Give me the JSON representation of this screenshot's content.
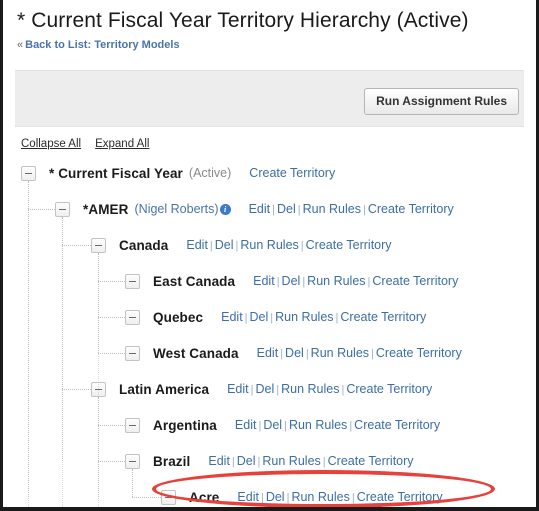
{
  "header": {
    "title": "* Current Fiscal Year Territory Hierarchy (Active)",
    "breadcrumb_chevron": "«",
    "breadcrumb_link": "Back to List: Territory Models"
  },
  "toolbar": {
    "run_assignment_rules_label": "Run Assignment Rules"
  },
  "tree_controls": {
    "collapse_all": "Collapse All",
    "expand_all": "Expand All"
  },
  "actions": {
    "edit": "Edit",
    "del": "Del",
    "run_rules": "Run Rules",
    "create_territory": "Create Territory",
    "separator": "|"
  },
  "colors": {
    "link_blue": "#3b6ea5",
    "annotation_red": "#e8413c",
    "toolbar_gray": "#ededed",
    "info_icon_blue": "#3b7ac4"
  },
  "tree": {
    "rows": [
      {
        "label": "* Current Fiscal Year",
        "meta": "(Active)",
        "owner": "",
        "has_info_icon": false,
        "depth": 0,
        "actions": [
          "create_territory"
        ],
        "highlighted": false
      },
      {
        "label": "*AMER",
        "meta": "",
        "owner": "(Nigel Roberts)",
        "has_info_icon": true,
        "depth": 1,
        "actions": [
          "edit",
          "del",
          "run_rules",
          "create_territory"
        ],
        "highlighted": false
      },
      {
        "label": "Canada",
        "meta": "",
        "owner": "",
        "has_info_icon": false,
        "depth": 2,
        "actions": [
          "edit",
          "del",
          "run_rules",
          "create_territory"
        ],
        "highlighted": false
      },
      {
        "label": "East Canada",
        "meta": "",
        "owner": "",
        "has_info_icon": false,
        "depth": 3,
        "actions": [
          "edit",
          "del",
          "run_rules",
          "create_territory"
        ],
        "highlighted": false
      },
      {
        "label": "Quebec",
        "meta": "",
        "owner": "",
        "has_info_icon": false,
        "depth": 3,
        "actions": [
          "edit",
          "del",
          "run_rules",
          "create_territory"
        ],
        "highlighted": false
      },
      {
        "label": "West Canada",
        "meta": "",
        "owner": "",
        "has_info_icon": false,
        "depth": 3,
        "actions": [
          "edit",
          "del",
          "run_rules",
          "create_territory"
        ],
        "highlighted": false
      },
      {
        "label": "Latin America",
        "meta": "",
        "owner": "",
        "has_info_icon": false,
        "depth": 2,
        "actions": [
          "edit",
          "del",
          "run_rules",
          "create_territory"
        ],
        "highlighted": false
      },
      {
        "label": "Argentina",
        "meta": "",
        "owner": "",
        "has_info_icon": false,
        "depth": 3,
        "actions": [
          "edit",
          "del",
          "run_rules",
          "create_territory"
        ],
        "highlighted": false
      },
      {
        "label": "Brazil",
        "meta": "",
        "owner": "",
        "has_info_icon": false,
        "depth": 3,
        "actions": [
          "edit",
          "del",
          "run_rules",
          "create_territory"
        ],
        "highlighted": false
      },
      {
        "label": "Acre",
        "meta": "",
        "owner": "",
        "has_info_icon": false,
        "depth": 4,
        "actions": [
          "edit",
          "del",
          "run_rules",
          "create_territory"
        ],
        "highlighted": true
      }
    ]
  }
}
